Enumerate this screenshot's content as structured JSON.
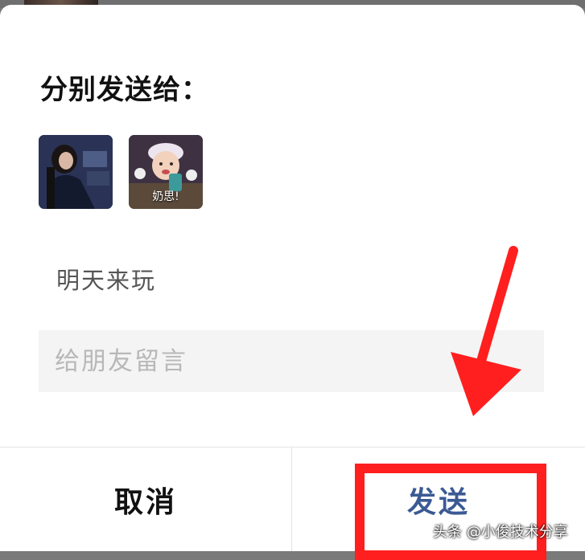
{
  "dialog": {
    "title": "分别发送给：",
    "recipients": [
      {
        "caption": ""
      },
      {
        "caption": "奶思!"
      }
    ],
    "message": "明天来玩",
    "leave_message_placeholder": "给朋友留言"
  },
  "footer": {
    "cancel_label": "取消",
    "send_label": "发送"
  },
  "annotation": {
    "highlight_color": "#ff1f1f",
    "watermark": "头条 @小俊技术分享"
  }
}
